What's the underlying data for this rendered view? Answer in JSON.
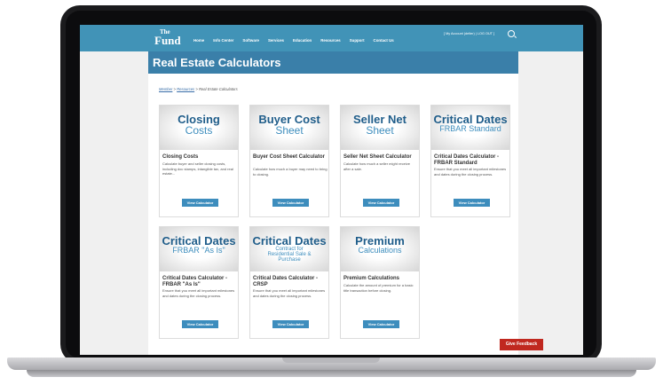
{
  "logo": {
    "line1": "The",
    "line2": "Fund"
  },
  "nav": [
    "Home",
    "Info Center",
    "Software",
    "Services",
    "Education",
    "Resources",
    "Support",
    "Contact Us"
  ],
  "account": "[ My Account (delter) | LOG OUT ]",
  "page_title": "Real Estate Calculators",
  "breadcrumb": {
    "item1": "Member",
    "sep": " > ",
    "item2": "Resources",
    "current": "Real Estate Calculators"
  },
  "button_label": "View Calculator",
  "cards": [
    {
      "thumb1": "Closing",
      "thumb2": "Costs",
      "title": "Closing Costs",
      "desc": "Calculate buyer and seller closing costs, including doc stamps, intangible tax, and real estate..."
    },
    {
      "thumb1": "Buyer Cost",
      "thumb2": "Sheet",
      "title": "Buyer Cost Sheet Calculator",
      "desc": "Calculate how much a buyer may need to bring to closing."
    },
    {
      "thumb1": "Seller Net",
      "thumb2": "Sheet",
      "title": "Seller Net Sheet Calculator",
      "desc": "Calculate how much a seller might receive after a sale."
    },
    {
      "thumb1": "Critical Dates",
      "thumb2": "FRBAR Standard",
      "title": "Critical Dates Calculator - FRBAR Standard",
      "desc": "Ensure that you meet all important milestones and dates during the closing process."
    },
    {
      "thumb1": "Critical Dates",
      "thumb2": "FRBAR \"As Is\"",
      "title": "Critical Dates Calculator - FRBAR \"As Is\"",
      "desc": "Ensure that you meet all important milestones and dates during the closing process."
    },
    {
      "thumb1": "Critical Dates",
      "thumb2": "Contract for Residential Sale & Purchase",
      "title": "Critical Dates Calculator - CRSP",
      "desc": "Ensure that you meet all important milestones and dates during the closing process."
    },
    {
      "thumb1": "Premium",
      "thumb2": "Calculations",
      "title": "Premium Calculations",
      "desc": "Calculate the amount of premium for a basic title transaction before closing."
    }
  ],
  "feedback": "Give Feedback"
}
